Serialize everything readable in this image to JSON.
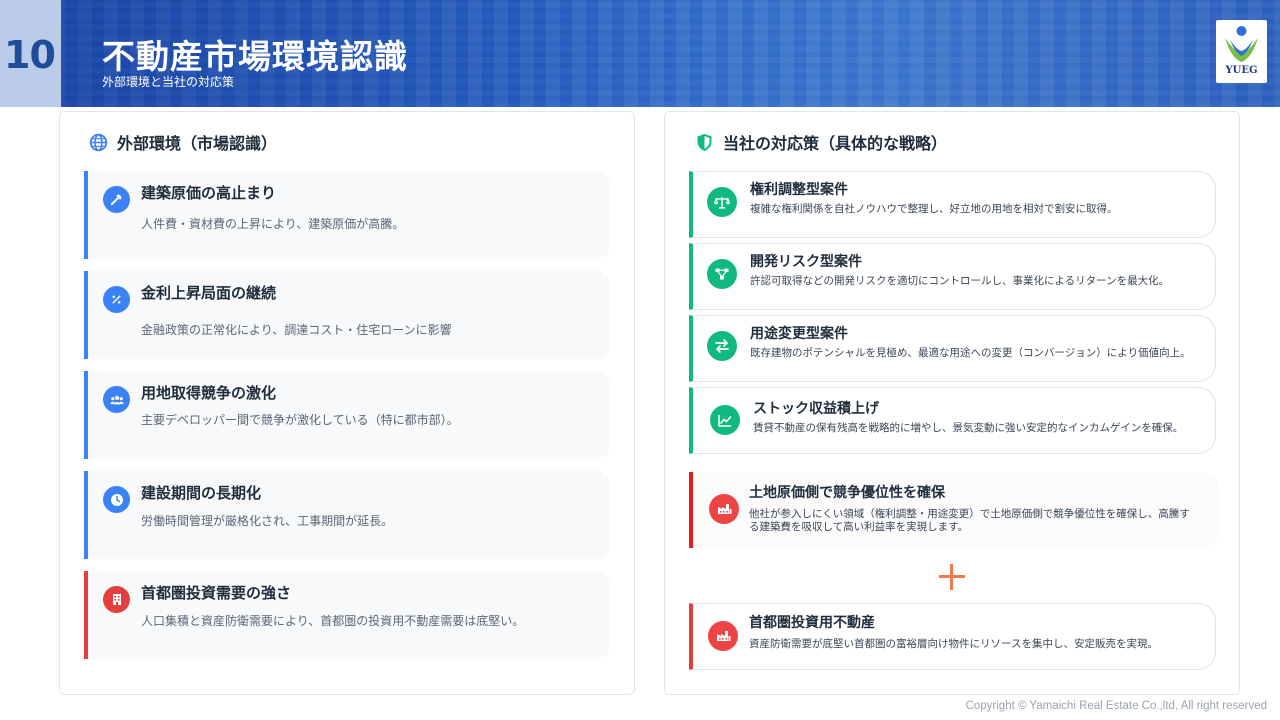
{
  "header": {
    "page_number": "10",
    "title": "不動産市場環境認識",
    "subtitle": "外部環境と当社の対応策",
    "logo_text": "YUEG"
  },
  "left_panel": {
    "title": "外部環境（市場認識）",
    "icon": "globe-icon",
    "items": [
      {
        "title": "建築原価の高止まり",
        "desc": "人件費・資材費の上昇により、建築原価が高騰。",
        "icon": "hammer-icon",
        "color": "#3b82f6"
      },
      {
        "title": "金利上昇局面の継続",
        "desc": "金融政策の正常化により、調達コスト・住宅ローンに影響",
        "icon": "percent-icon",
        "color": "#3b82f6"
      },
      {
        "title": "用地取得競争の激化",
        "desc": "主要デベロッパー間で競争が激化している（特に都市部）。",
        "icon": "users-icon",
        "color": "#3b82f6"
      },
      {
        "title": "建設期間の長期化",
        "desc": "労働時間管理が厳格化され、工事期間が延長。",
        "icon": "clock-icon",
        "color": "#3b82f6"
      },
      {
        "title": "首都圏投資需要の強さ",
        "desc": "人口集積と資産防衛需要により、首都圏の投資用不動産需要は底堅い。",
        "icon": "building-icon",
        "color": "#e53e3e"
      }
    ]
  },
  "right_panel": {
    "title": "当社の対応策（具体的な戦略）",
    "icon": "shield-icon",
    "items": [
      {
        "title": "権利調整型案件",
        "desc": "複雑な権利関係を自社ノウハウで整理し、好立地の用地を相対で割安に取得。",
        "icon": "scale-icon",
        "color": "#10b981"
      },
      {
        "title": "開発リスク型案件",
        "desc": "許認可取得などの開発リスクを適切にコントロールし、事業化によるリターンを最大化。",
        "icon": "network-icon",
        "color": "#10b981"
      },
      {
        "title": "用途変更型案件",
        "desc": "既存建物のポテンシャルを見極め、最適な用途への変更（コンバージョン）により価値向上。",
        "icon": "swap-icon",
        "color": "#10b981"
      },
      {
        "title": "ストック収益積上げ",
        "desc": "賃貸不動産の保有残高を戦略的に増やし、景気変動に強い安定的なインカムゲインを確保。",
        "icon": "chart-line-icon",
        "color": "#10b981"
      }
    ],
    "key_strategy": {
      "title": "土地原価側で競争優位性を確保",
      "desc": "他社が参入しにくい領域（権利調整・用途変更）で土地原価側で競争優位性を確保し、高騰する建築費を吸収して高い利益率を実現します。",
      "icon": "factory-icon",
      "color": "#e11d1d"
    },
    "plus_icon": "plus-icon",
    "capital_strategy": {
      "title": "首都圏投資用不動産",
      "desc": "資産防衛需要が底堅い首都圏の富裕層向け物件にリソースを集中し、安定販売を実現。",
      "icon": "factory-icon",
      "color": "#e53e3e"
    }
  },
  "footer": {
    "copyright": "Copyright © Yamaichi Real Estate Co.,ltd, All right reserved"
  }
}
